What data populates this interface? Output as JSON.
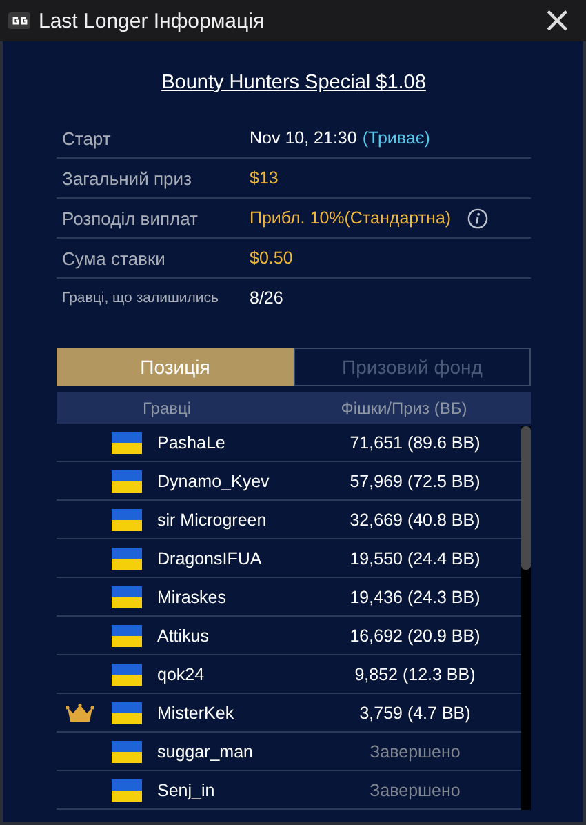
{
  "window": {
    "title": "Last Longer Інформація",
    "close": "×"
  },
  "tournament": {
    "title": "Bounty Hunters Special $1.08"
  },
  "info": [
    {
      "label": "Старт",
      "value": "Nov 10, 21:30",
      "note": "(Триває)",
      "kind": "plain",
      "small": false,
      "info_button": false
    },
    {
      "label": "Загальний приз",
      "value": "$13",
      "kind": "gold",
      "small": false,
      "info_button": false
    },
    {
      "label": "Розподіл виплат",
      "value": "Прибл. 10%(Стандартна)",
      "kind": "gold",
      "small": false,
      "info_button": true
    },
    {
      "label": "Сума ставки",
      "value": "$0.50",
      "kind": "gold",
      "small": false,
      "info_button": false
    },
    {
      "label": "Гравці, що залишились",
      "value": "8/26",
      "kind": "plain",
      "small": true,
      "info_button": false
    }
  ],
  "tabs": [
    {
      "label": "Позиція",
      "selected": true
    },
    {
      "label": "Призовий фонд",
      "selected": false
    }
  ],
  "table": {
    "columns": [
      "Гравці",
      "Фішки/Приз (ВБ)"
    ],
    "rows": [
      {
        "player": "PashaLe",
        "chips": "71,651 (89.6 BB)",
        "kind": "active",
        "crown": false
      },
      {
        "player": "Dynamo_Kyev",
        "chips": "57,969 (72.5 BB)",
        "kind": "active",
        "crown": false
      },
      {
        "player": "sir Microgreen",
        "chips": "32,669 (40.8 BB)",
        "kind": "active",
        "crown": false
      },
      {
        "player": "DragonsIFUA",
        "chips": "19,550 (24.4 BB)",
        "kind": "active",
        "crown": false
      },
      {
        "player": "Miraskes",
        "chips": "19,436 (24.3 BB)",
        "kind": "active",
        "crown": false
      },
      {
        "player": "Attikus",
        "chips": "16,692 (20.9 BB)",
        "kind": "active",
        "crown": false
      },
      {
        "player": "qok24",
        "chips": "9,852 (12.3 BB)",
        "kind": "active",
        "crown": false
      },
      {
        "player": "MisterKek",
        "chips": "3,759 (4.7 BB)",
        "kind": "active",
        "crown": true
      },
      {
        "player": "suggar_man",
        "chips": "Завершено",
        "kind": "finished",
        "crown": false
      },
      {
        "player": "Senj_in",
        "chips": "Завершено",
        "kind": "finished",
        "crown": false
      }
    ]
  }
}
